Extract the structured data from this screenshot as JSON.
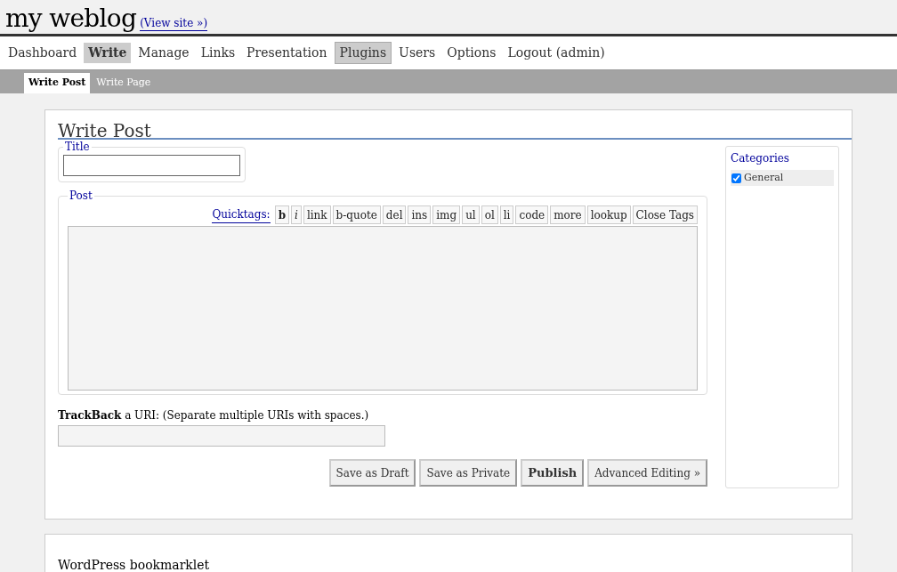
{
  "header": {
    "site_title": "my weblog",
    "view_site_link": "(View site »)"
  },
  "nav": [
    {
      "label": "Dashboard",
      "selected": false
    },
    {
      "label": "Write",
      "selected": true
    },
    {
      "label": "Manage",
      "selected": false
    },
    {
      "label": "Links",
      "selected": false
    },
    {
      "label": "Presentation",
      "selected": false
    },
    {
      "label": "Plugins",
      "selected": false,
      "highlighted": true
    },
    {
      "label": "Users",
      "selected": false
    },
    {
      "label": "Options",
      "selected": false
    },
    {
      "label": "Logout (admin)",
      "selected": false
    }
  ],
  "subnav": [
    {
      "label": "Write Post",
      "selected": true
    },
    {
      "label": "Write Page",
      "selected": false
    }
  ],
  "write_post": {
    "heading": "Write Post",
    "title_label": "Title",
    "post_label": "Post",
    "quicktags_label": "Quicktags:",
    "quicktags": [
      {
        "label": "b",
        "kind": "bold"
      },
      {
        "label": "i",
        "kind": "italic"
      },
      {
        "label": "link",
        "kind": "plain"
      },
      {
        "label": "b-quote",
        "kind": "plain"
      },
      {
        "label": "del",
        "kind": "plain"
      },
      {
        "label": "ins",
        "kind": "plain"
      },
      {
        "label": "img",
        "kind": "plain"
      },
      {
        "label": "ul",
        "kind": "plain"
      },
      {
        "label": "ol",
        "kind": "plain"
      },
      {
        "label": "li",
        "kind": "plain"
      },
      {
        "label": "code",
        "kind": "plain"
      },
      {
        "label": "more",
        "kind": "plain"
      },
      {
        "label": "lookup",
        "kind": "plain"
      },
      {
        "label": "Close Tags",
        "kind": "plain"
      }
    ],
    "trackback_text": "**TrackBack** a URI: (Separate multiple URIs with spaces.)",
    "buttons": [
      {
        "label": "Save as Draft",
        "kind": "normal"
      },
      {
        "label": "Save as Private",
        "kind": "normal"
      },
      {
        "label": "Publish",
        "kind": "primary"
      },
      {
        "label": "Advanced Editing »",
        "kind": "normal"
      }
    ]
  },
  "categories": {
    "heading": "Categories",
    "items": [
      {
        "label": "General",
        "checked": true
      }
    ]
  },
  "bookmarklet": {
    "heading": "WordPress bookmarklet"
  }
}
